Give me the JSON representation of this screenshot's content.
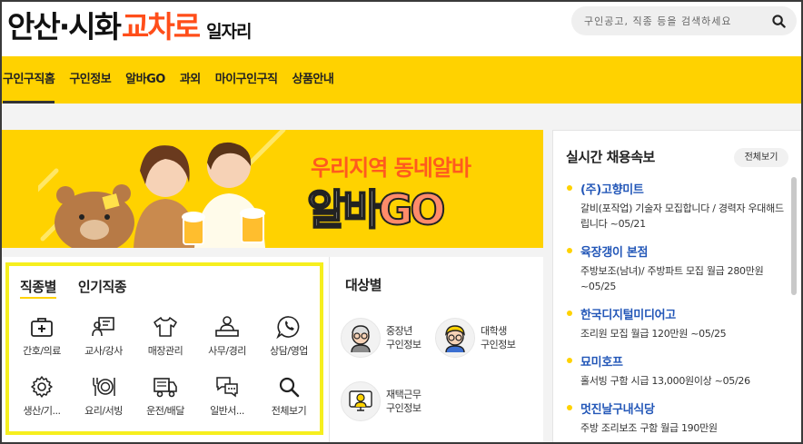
{
  "brand": {
    "part1": "안산·시화",
    "part2": "교차로",
    "part3": "일자리",
    "accent": "#ff4e1a"
  },
  "search": {
    "placeholder": "구인공고, 직종 등을 검색하세요",
    "icon": "search-icon"
  },
  "nav": {
    "color": "#ffd200",
    "items": [
      {
        "label": "구인구직홈"
      },
      {
        "label": "구인정보"
      },
      {
        "label": "알바GO"
      },
      {
        "label": "과외"
      },
      {
        "label": "마이구인구직"
      },
      {
        "label": "상품안내"
      }
    ]
  },
  "banner": {
    "line1": "우리지역 동네알바",
    "line2a": "알바",
    "line2b": "GO"
  },
  "jobs": {
    "tabs": [
      {
        "label": "직종별"
      },
      {
        "label": "인기직종"
      }
    ],
    "categories": [
      {
        "label": "간호/의료",
        "icon": "medical-kit-icon"
      },
      {
        "label": "교사/강사",
        "icon": "teacher-board-icon"
      },
      {
        "label": "매장관리",
        "icon": "shirt-icon"
      },
      {
        "label": "사무/경리",
        "icon": "office-worker-icon"
      },
      {
        "label": "상담/영업",
        "icon": "phone-bubble-icon"
      },
      {
        "label": "생산/기...",
        "icon": "gear-icon"
      },
      {
        "label": "요리/서빙",
        "icon": "plate-cutlery-icon"
      },
      {
        "label": "운전/배달",
        "icon": "truck-icon"
      },
      {
        "label": "일반서...",
        "icon": "chat-bubbles-icon"
      },
      {
        "label": "전체보기",
        "icon": "search-icon"
      }
    ]
  },
  "target": {
    "title": "대상별",
    "items": [
      {
        "line1": "중장년",
        "line2": "구인정보",
        "icon": "senior-avatar-icon"
      },
      {
        "line1": "대학생",
        "line2": "구인정보",
        "icon": "student-avatar-icon"
      },
      {
        "line1": "재택근무",
        "line2": "구인정보",
        "icon": "remote-work-icon"
      }
    ]
  },
  "realtime": {
    "title": "실시간 채용속보",
    "view_all": "전체보기",
    "items": [
      {
        "company": "(주)고향미트",
        "desc": "갈비(포작업) 기술자 모집합니다 / 경력자 우대해드립니다 ~05/21"
      },
      {
        "company": "육장갱이 본점",
        "desc": "주방보조(남녀)/ 주방파트 모집 월급 280만원 ~05/25"
      },
      {
        "company": "한국디지털미디어고",
        "desc": "조리원 모집 월급 120만원 ~05/25"
      },
      {
        "company": "묘미호프",
        "desc": "홀서빙 구함 시급 13,000원이상 ~05/26"
      },
      {
        "company": "멋진날구내식당",
        "desc": "주방 조리보조 구함 월급 190만원"
      }
    ]
  }
}
